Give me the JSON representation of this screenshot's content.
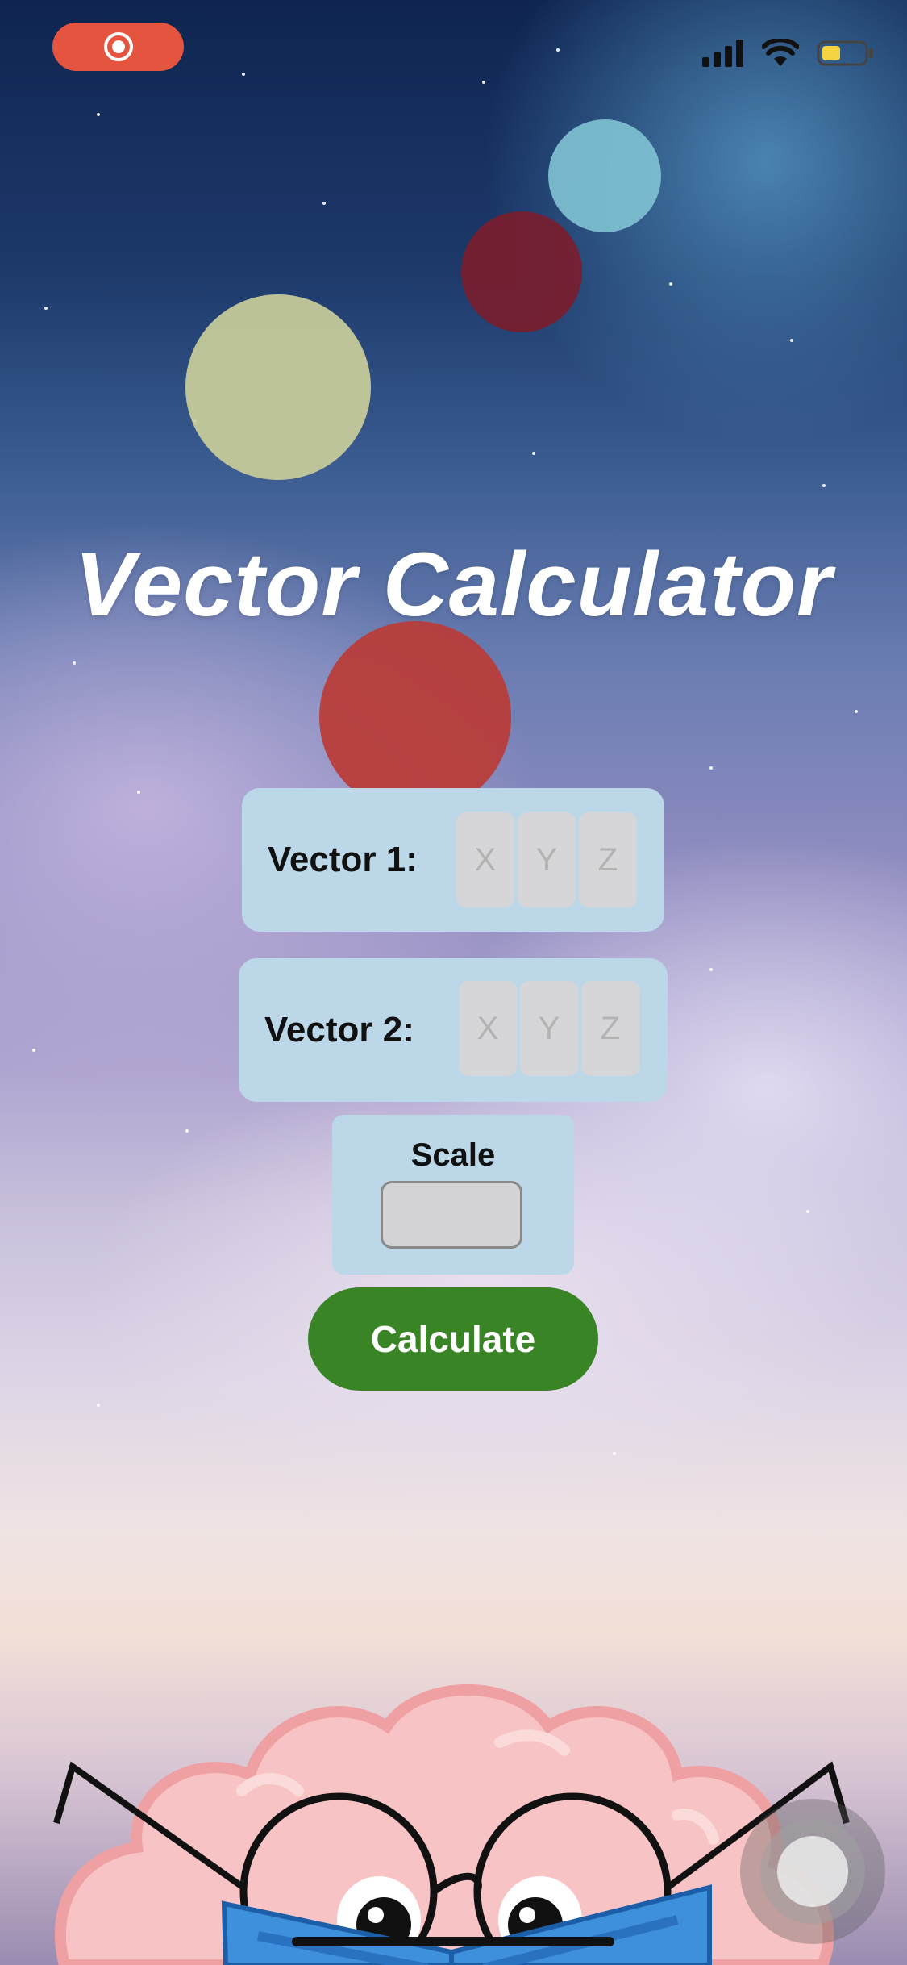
{
  "app": {
    "title": "Vector Calculator"
  },
  "status_bar": {
    "recording_color": "#e5543f",
    "icons": [
      "record-icon",
      "signal-icon",
      "wifi-icon",
      "battery-icon"
    ],
    "battery_color": "#f5d442"
  },
  "vector1": {
    "label": "Vector 1:",
    "x_placeholder": "X",
    "y_placeholder": "Y",
    "z_placeholder": "Z"
  },
  "vector2": {
    "label": "Vector 2:",
    "x_placeholder": "X",
    "y_placeholder": "Y",
    "z_placeholder": "Z"
  },
  "scale": {
    "label": "Scale",
    "value": ""
  },
  "calculate": {
    "label": "Calculate",
    "color": "#398525"
  },
  "decor": {
    "bubble_colors": [
      "#7fc1d1",
      "#7a1d2e",
      "#c8cc9a",
      "#bb3b36"
    ],
    "mascot": "brain-reading-book-illustration"
  }
}
